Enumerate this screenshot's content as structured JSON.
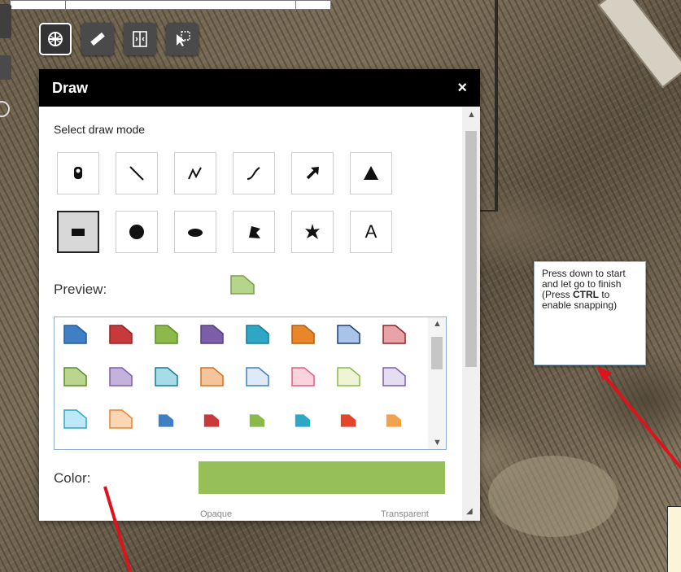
{
  "app": {
    "panel_title": "Draw",
    "close_glyph": "×"
  },
  "toolbar": {
    "buttons": [
      {
        "name": "layers-icon",
        "active": true
      },
      {
        "name": "measure-ruler-icon",
        "active": false
      },
      {
        "name": "swipe-compare-icon",
        "active": false
      },
      {
        "name": "select-pointer-icon",
        "active": false
      }
    ]
  },
  "draw": {
    "mode_label": "Select draw mode",
    "modes": [
      {
        "id": "point",
        "icon": "point-marker-icon"
      },
      {
        "id": "line",
        "icon": "line-icon"
      },
      {
        "id": "polyline",
        "icon": "polyline-icon"
      },
      {
        "id": "freehand-polyline",
        "icon": "freehand-line-icon"
      },
      {
        "id": "arrow",
        "icon": "arrow-icon"
      },
      {
        "id": "triangle",
        "icon": "triangle-icon"
      },
      {
        "id": "rectangle",
        "icon": "rectangle-icon",
        "selected": true
      },
      {
        "id": "circle",
        "icon": "circle-icon"
      },
      {
        "id": "ellipse",
        "icon": "ellipse-icon"
      },
      {
        "id": "polygon",
        "icon": "polygon-icon"
      },
      {
        "id": "freehand-polygon",
        "icon": "freehand-polygon-icon"
      },
      {
        "id": "text",
        "icon": "text-icon",
        "text": "A"
      }
    ],
    "preview_label": "Preview:",
    "preview_color": "#b5d58c",
    "preview_stroke": "#7a9e4a",
    "color_label": "Color:",
    "color_value": "#96bf5a",
    "opaque_label": "Opaque",
    "transparent_label": "Transparent"
  },
  "palette": {
    "rows": [
      [
        {
          "fill": "#3f7fc4",
          "stroke": "#2b5c94"
        },
        {
          "fill": "#c8393b",
          "stroke": "#8e2426"
        },
        {
          "fill": "#8cb84c",
          "stroke": "#5f8a2c"
        },
        {
          "fill": "#7b5ea8",
          "stroke": "#55407a"
        },
        {
          "fill": "#2ea7c6",
          "stroke": "#1b7892"
        },
        {
          "fill": "#e9862a",
          "stroke": "#b15e12"
        },
        {
          "fill": "#a9c4e8",
          "stroke": "#1f3d6e"
        },
        {
          "fill": "#e8a3a8",
          "stroke": "#8e2426"
        }
      ],
      [
        {
          "fill": "#b9d58e",
          "stroke": "#5f8a2c"
        },
        {
          "fill": "#c3b3dc",
          "stroke": "#7b5ea8"
        },
        {
          "fill": "#a8dbe8",
          "stroke": "#1b7892"
        },
        {
          "fill": "#f6c49a",
          "stroke": "#d4701c"
        },
        {
          "fill": "#dfe9f8",
          "stroke": "#3f7fc4"
        },
        {
          "fill": "#fbd3dc",
          "stroke": "#e85a7e"
        },
        {
          "fill": "#eef5d6",
          "stroke": "#8cb84c"
        },
        {
          "fill": "#e6ddf3",
          "stroke": "#7b5ea8"
        }
      ],
      [
        {
          "fill": "#bfe8f6",
          "stroke": "#2ea7c6"
        },
        {
          "fill": "#fcd6b4",
          "stroke": "#e9862a"
        },
        {
          "fill": "#3f7fc4",
          "stroke": "#3f7fc4",
          "small": true
        },
        {
          "fill": "#c8393b",
          "stroke": "#c8393b",
          "small": true
        },
        {
          "fill": "#8cb84c",
          "stroke": "#8cb84c",
          "small": true
        },
        {
          "fill": "#2ea7c6",
          "stroke": "#2ea7c6",
          "small": true
        },
        {
          "fill": "#e2452b",
          "stroke": "#e2452b",
          "small": true
        },
        {
          "fill": "#f0a24c",
          "stroke": "#f0a24c",
          "small": true
        }
      ]
    ]
  },
  "tooltip": {
    "line1": "Press down to start and let go to finish",
    "paren_open": "(Press ",
    "key": "CTRL",
    "paren_rest": " to enable snapping)"
  },
  "colors": {
    "annotation_arrow": "#e0121c",
    "header_bg": "#000000"
  }
}
